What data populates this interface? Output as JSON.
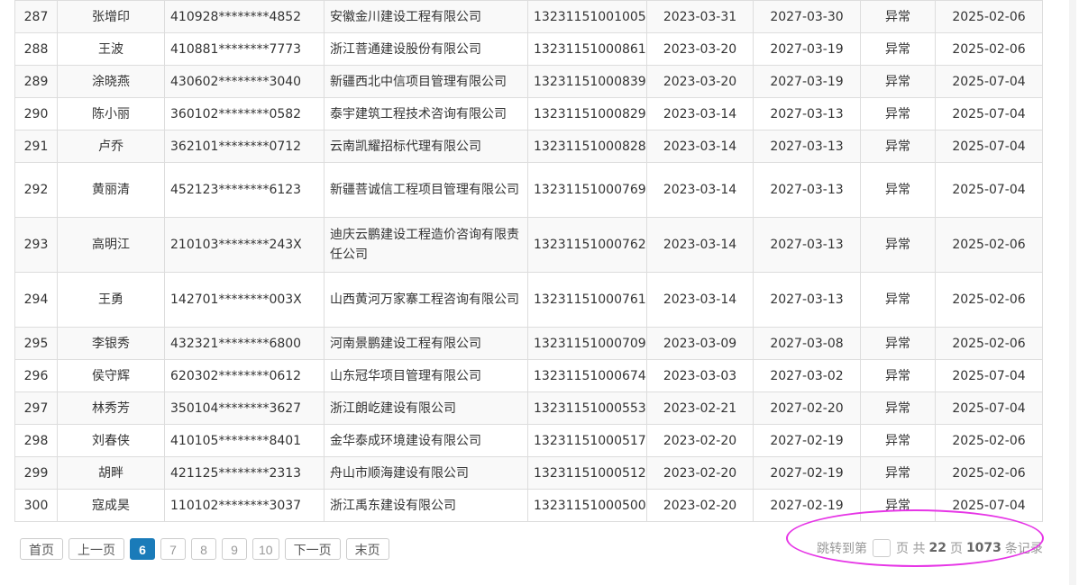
{
  "table": {
    "rows": [
      {
        "no": "287",
        "name": "张增印",
        "id": "410928********4852",
        "company": "安徽金川建设工程有限公司",
        "cert": "13231151001005",
        "issue": "2023-03-31",
        "expire": "2027-03-30",
        "status": "异常",
        "date": "2025-02-06"
      },
      {
        "no": "288",
        "name": "王波",
        "id": "410881********7773",
        "company": "浙江菩通建设股份有限公司",
        "cert": "13231151000861",
        "issue": "2023-03-20",
        "expire": "2027-03-19",
        "status": "异常",
        "date": "2025-02-06"
      },
      {
        "no": "289",
        "name": "涂晓燕",
        "id": "430602********3040",
        "company": "新疆西北中信项目管理有限公司",
        "cert": "13231151000839",
        "issue": "2023-03-20",
        "expire": "2027-03-19",
        "status": "异常",
        "date": "2025-07-04"
      },
      {
        "no": "290",
        "name": "陈小丽",
        "id": "360102********0582",
        "company": "泰宇建筑工程技术咨询有限公司",
        "cert": "13231151000829",
        "issue": "2023-03-14",
        "expire": "2027-03-13",
        "status": "异常",
        "date": "2025-07-04"
      },
      {
        "no": "291",
        "name": "卢乔",
        "id": "362101********0712",
        "company": "云南凯耀招标代理有限公司",
        "cert": "13231151000828",
        "issue": "2023-03-14",
        "expire": "2027-03-13",
        "status": "异常",
        "date": "2025-07-04"
      },
      {
        "no": "292",
        "name": "黄丽清",
        "id": "452123********6123",
        "company": "新疆菩诚信工程项目管理有限公司",
        "cert": "13231151000769",
        "issue": "2023-03-14",
        "expire": "2027-03-13",
        "status": "异常",
        "date": "2025-07-04"
      },
      {
        "no": "293",
        "name": "高明江",
        "id": "210103********243X",
        "company": "迪庆云鹏建设工程造价咨询有限责任公司",
        "cert": "13231151000762",
        "issue": "2023-03-14",
        "expire": "2027-03-13",
        "status": "异常",
        "date": "2025-02-06"
      },
      {
        "no": "294",
        "name": "王勇",
        "id": "142701********003X",
        "company": "山西黄河万家寨工程咨询有限公司",
        "cert": "13231151000761",
        "issue": "2023-03-14",
        "expire": "2027-03-13",
        "status": "异常",
        "date": "2025-02-06"
      },
      {
        "no": "295",
        "name": "李银秀",
        "id": "432321********6800",
        "company": "河南景鹏建设工程有限公司",
        "cert": "13231151000709",
        "issue": "2023-03-09",
        "expire": "2027-03-08",
        "status": "异常",
        "date": "2025-02-06"
      },
      {
        "no": "296",
        "name": "侯守辉",
        "id": "620302********0612",
        "company": "山东冠华项目管理有限公司",
        "cert": "13231151000674",
        "issue": "2023-03-03",
        "expire": "2027-03-02",
        "status": "异常",
        "date": "2025-07-04"
      },
      {
        "no": "297",
        "name": "林秀芳",
        "id": "350104********3627",
        "company": "浙江朗屹建设有限公司",
        "cert": "13231151000553",
        "issue": "2023-02-21",
        "expire": "2027-02-20",
        "status": "异常",
        "date": "2025-07-04"
      },
      {
        "no": "298",
        "name": "刘春侠",
        "id": "410105********8401",
        "company": "金华泰成环境建设有限公司",
        "cert": "13231151000517",
        "issue": "2023-02-20",
        "expire": "2027-02-19",
        "status": "异常",
        "date": "2025-02-06"
      },
      {
        "no": "299",
        "name": "胡畔",
        "id": "421125********2313",
        "company": "舟山市顺海建设有限公司",
        "cert": "13231151000512",
        "issue": "2023-02-20",
        "expire": "2027-02-19",
        "status": "异常",
        "date": "2025-02-06"
      },
      {
        "no": "300",
        "name": "寇成昊",
        "id": "110102********3037",
        "company": "浙江禹东建设有限公司",
        "cert": "13231151000500",
        "issue": "2023-02-20",
        "expire": "2027-02-19",
        "status": "异常",
        "date": "2025-07-04"
      }
    ]
  },
  "pagination": {
    "first": "首页",
    "prev": "上一页",
    "pages": [
      "6",
      "7",
      "8",
      "9",
      "10"
    ],
    "current": "6",
    "next": "下一页",
    "last": "末页",
    "jump_prefix": "跳转到第",
    "jump_suffix": "页 共",
    "total_pages": "22",
    "pages_unit": "页",
    "total_records": "1073",
    "records_unit": "条记录"
  },
  "colors": {
    "accent": "#1a7bb9",
    "annotation": "#e635e6"
  }
}
